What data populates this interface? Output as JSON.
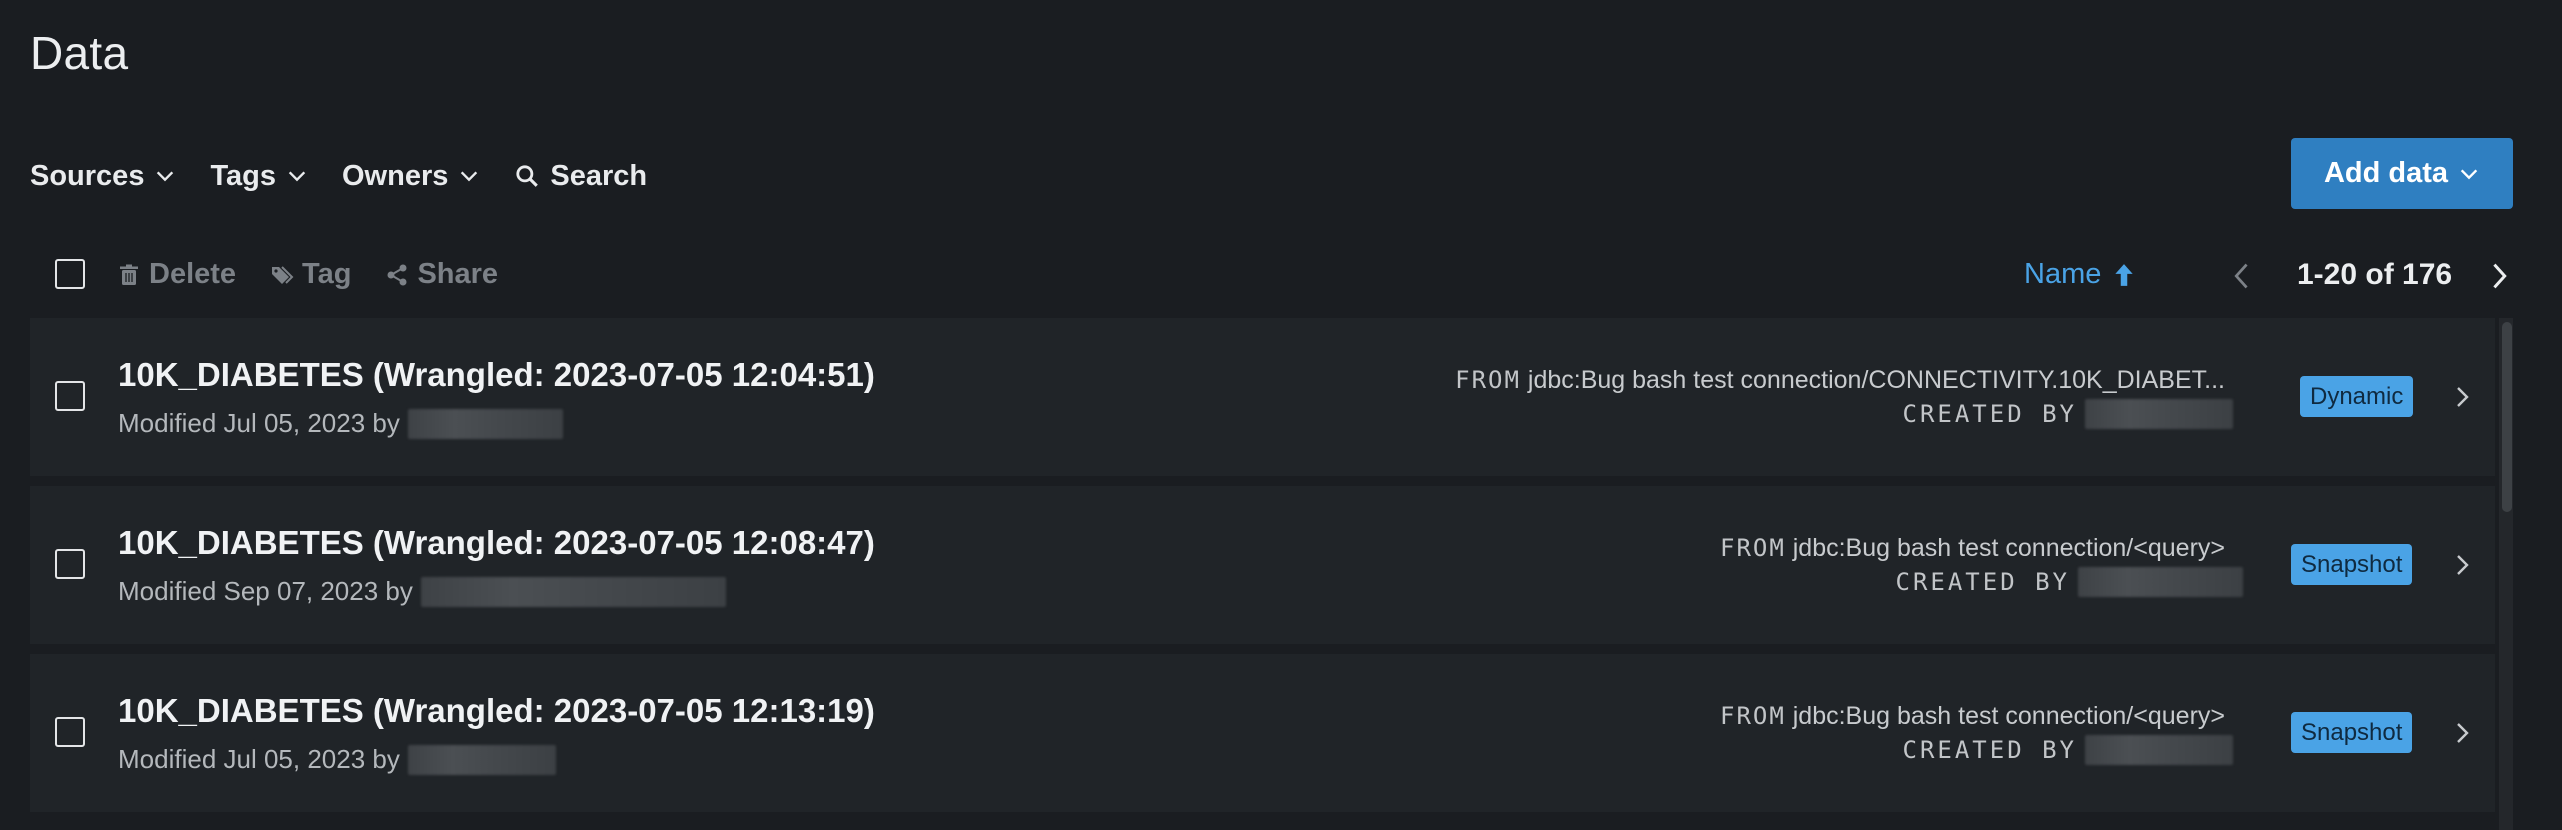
{
  "page": {
    "title": "Data"
  },
  "filters": {
    "sources": "Sources",
    "tags": "Tags",
    "owners": "Owners",
    "search": "Search"
  },
  "add_data": {
    "label": "Add data"
  },
  "toolbar": {
    "delete": "Delete",
    "tag": "Tag",
    "share": "Share",
    "sort_label": "Name",
    "pagination": "1-20 of 176"
  },
  "rows": [
    {
      "title": "10K_DIABETES (Wrangled: 2023-07-05 12:04:51)",
      "modified": "Modified Jul 05, 2023 by",
      "from_label": "FROM",
      "source": "jdbc:Bug bash test connection/CONNECTIVITY.10K_DIABET...",
      "created_by": "CREATED BY",
      "badge": "Dynamic"
    },
    {
      "title": "10K_DIABETES (Wrangled: 2023-07-05 12:08:47)",
      "modified": "Modified Sep 07, 2023 by",
      "from_label": "FROM",
      "source": "jdbc:Bug bash test connection/<query>",
      "created_by": "CREATED BY",
      "badge": "Snapshot"
    },
    {
      "title": "10K_DIABETES (Wrangled: 2023-07-05 12:13:19)",
      "modified": "Modified Jul 05, 2023 by",
      "from_label": "FROM",
      "source": "jdbc:Bug bash test connection/<query>",
      "created_by": "CREATED BY",
      "badge": "Snapshot"
    }
  ],
  "colors": {
    "background": "#1a1d21",
    "row_background": "#202428",
    "accent": "#2f7fc1",
    "badge": "#4aa3e6"
  }
}
